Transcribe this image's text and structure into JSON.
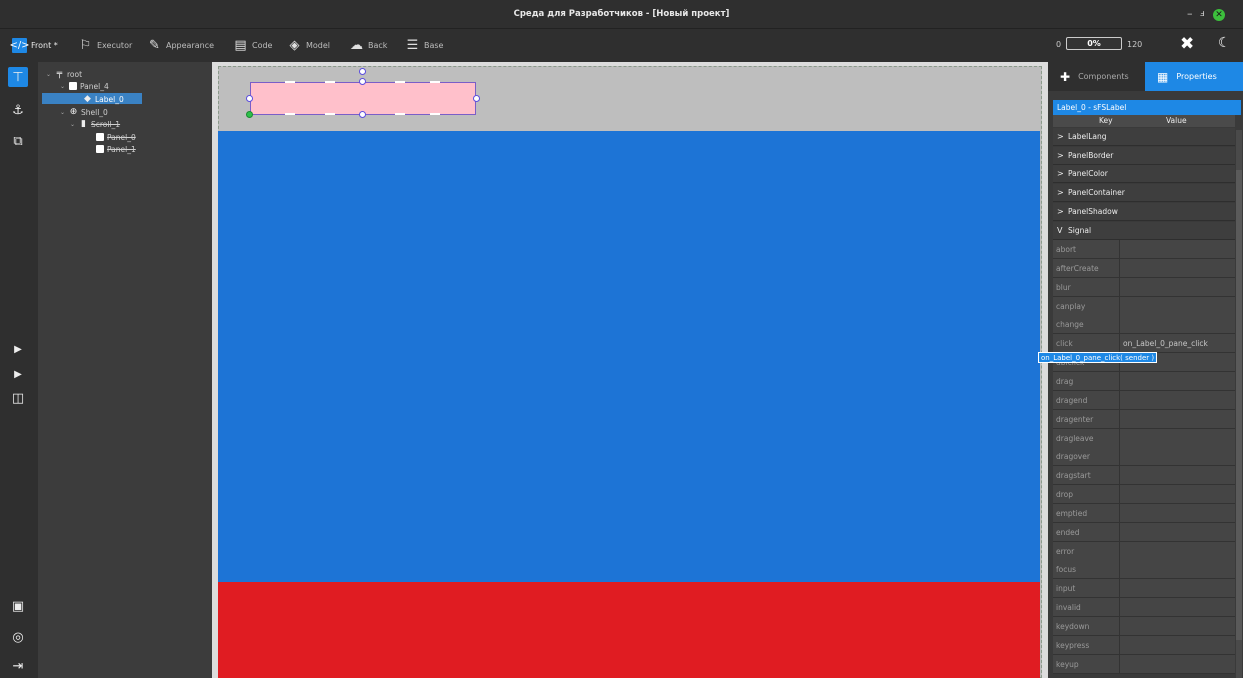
{
  "window": {
    "title": "Среда для Разработчиков - [Новый проект]",
    "minimize": "–",
    "restore": "ⅎ",
    "close": "✕"
  },
  "toolbar": {
    "tabs": [
      {
        "label": "Front *",
        "icon": "code-window-icon"
      },
      {
        "label": "Executor",
        "icon": "flowchart-icon"
      },
      {
        "label": "Appearance",
        "icon": "paint-icon"
      },
      {
        "label": "Code",
        "icon": "document-icon"
      },
      {
        "label": "Model",
        "icon": "layers-icon"
      },
      {
        "label": "Back",
        "icon": "cloud-icon"
      },
      {
        "label": "Base",
        "icon": "database-icon"
      }
    ],
    "zoom": {
      "min": "0",
      "value": "0%",
      "max": "120",
      "percent": 0
    }
  },
  "tree": {
    "nodes": [
      {
        "label": "root"
      },
      {
        "label": "Panel_4"
      },
      {
        "label": "Label_0"
      },
      {
        "label": "Shell_0"
      },
      {
        "label": "Scroll_1"
      },
      {
        "label": "Panel_0"
      },
      {
        "label": "Panel_1"
      }
    ]
  },
  "right_panel": {
    "tabs": {
      "components": "Components",
      "properties": "Properties"
    },
    "header": "Label_0 - sFSLabel",
    "columns": {
      "key": "Key",
      "value": "Value"
    },
    "groups": [
      {
        "chev": ">",
        "label": "LabelLang"
      },
      {
        "chev": ">",
        "label": "PanelBorder"
      },
      {
        "chev": ">",
        "label": "PanelColor"
      },
      {
        "chev": ">",
        "label": "PanelContainer"
      },
      {
        "chev": ">",
        "label": "PanelShadow"
      },
      {
        "chev": "V",
        "label": "Signal"
      }
    ],
    "rows": [
      {
        "key": "abort",
        "value": ""
      },
      {
        "key": "afterCreate",
        "value": ""
      },
      {
        "key": "blur",
        "value": ""
      },
      {
        "key": "canplay",
        "value": ""
      },
      {
        "key": "change",
        "value": ""
      },
      {
        "key": "click",
        "value": "on_Label_0_pane_click"
      },
      {
        "key": "dblclick",
        "value": ""
      },
      {
        "key": "drag",
        "value": ""
      },
      {
        "key": "dragend",
        "value": ""
      },
      {
        "key": "dragenter",
        "value": ""
      },
      {
        "key": "dragleave",
        "value": ""
      },
      {
        "key": "dragover",
        "value": ""
      },
      {
        "key": "dragstart",
        "value": ""
      },
      {
        "key": "drop",
        "value": ""
      },
      {
        "key": "emptied",
        "value": ""
      },
      {
        "key": "ended",
        "value": ""
      },
      {
        "key": "error",
        "value": ""
      },
      {
        "key": "focus",
        "value": ""
      },
      {
        "key": "input",
        "value": ""
      },
      {
        "key": "invalid",
        "value": ""
      },
      {
        "key": "keydown",
        "value": ""
      },
      {
        "key": "keypress",
        "value": ""
      },
      {
        "key": "keyup",
        "value": ""
      }
    ],
    "tooltip": "on_Label_0_pane_click( sender )"
  },
  "colors": {
    "accent": "#1e88e5",
    "label_fill": "#ffc0cb",
    "band_blue": "#1d74d6",
    "band_red": "#e01c22"
  }
}
